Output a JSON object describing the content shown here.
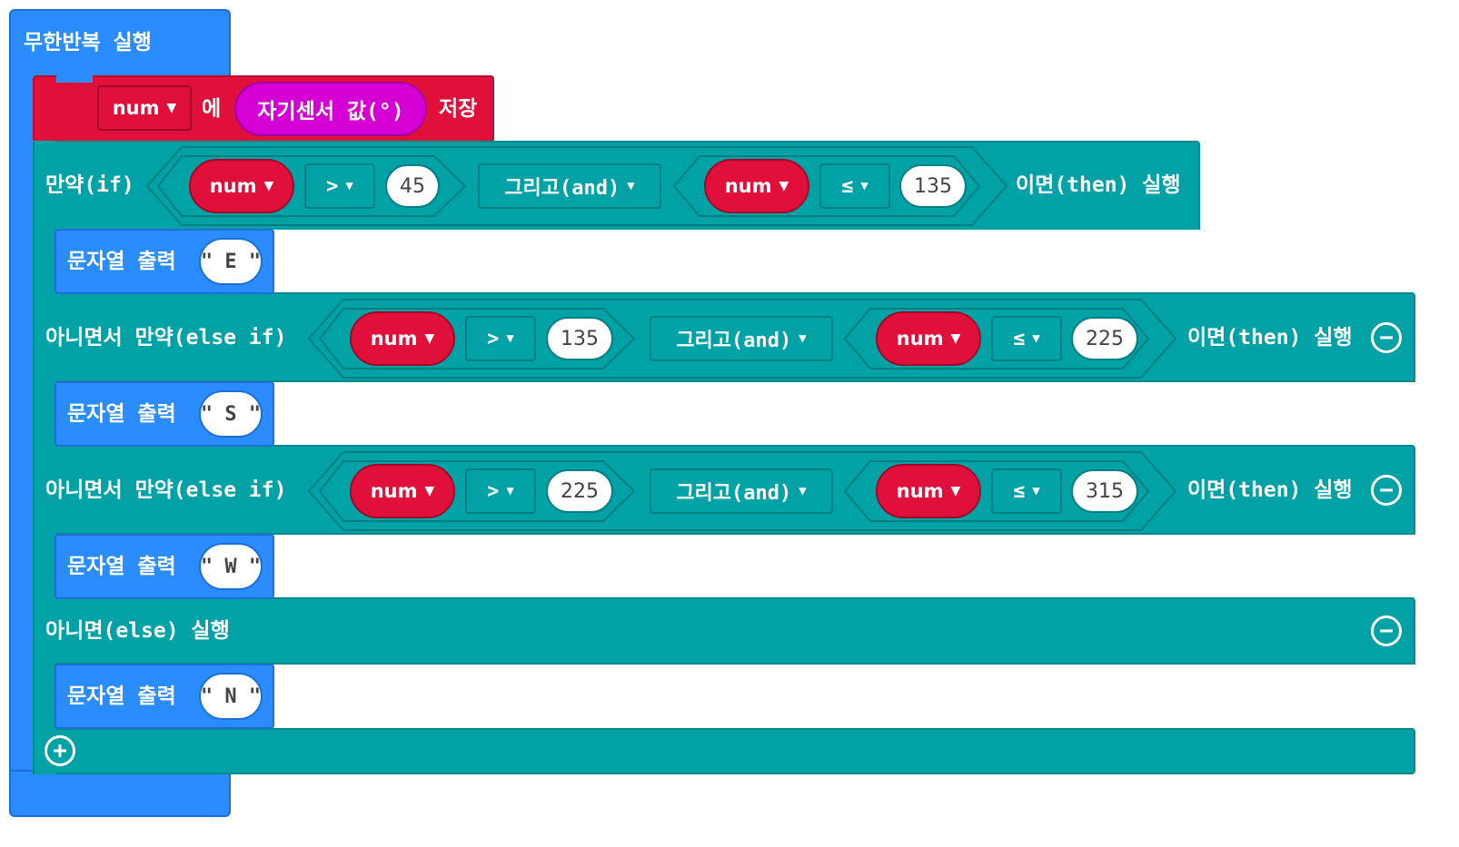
{
  "forever": {
    "label": "무한반복 실행"
  },
  "set_block": {
    "variable": "num",
    "middle": "에",
    "sensor": "자기센서 값(°)",
    "end": "저장"
  },
  "if_block": {
    "if_label": "만약(if)",
    "then_label": "이면(then) 실행",
    "and_label": "그리고(and)",
    "else_if_label": "아니면서 만약(else if)",
    "else_label": "아니면(else) 실행",
    "branches": [
      {
        "left_var": "num",
        "left_op": ">",
        "left_val": "45",
        "right_var": "num",
        "right_op": "≤",
        "right_val": "135",
        "output": "E"
      },
      {
        "left_var": "num",
        "left_op": ">",
        "left_val": "135",
        "right_var": "num",
        "right_op": "≤",
        "right_val": "225",
        "output": "S"
      },
      {
        "left_var": "num",
        "left_op": ">",
        "left_val": "225",
        "right_var": "num",
        "right_op": "≤",
        "right_val": "315",
        "output": "W"
      }
    ],
    "else_output": "N"
  },
  "print_label": "문자열 출력",
  "icons": {
    "dropdown": "chevron-down-icon",
    "remove": "minus-circle-icon",
    "add": "plus-circle-icon"
  },
  "colors": {
    "loops": "#2a8cff",
    "variables": "#e0103a",
    "logic": "#00a2a6",
    "input": "#d400d4"
  }
}
